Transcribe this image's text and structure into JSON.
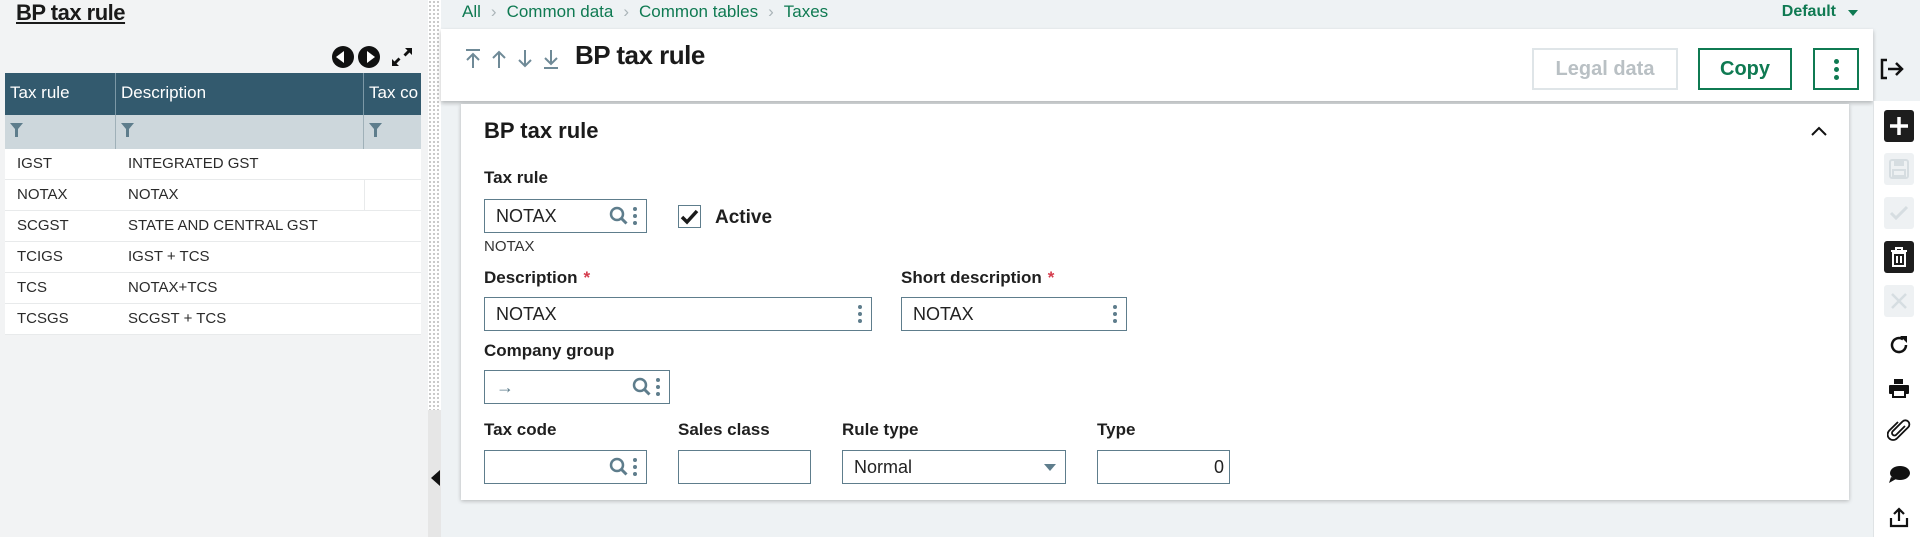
{
  "left_panel": {
    "title": "BP tax rule",
    "grid": {
      "columns": [
        "Tax rule",
        "Description",
        "Tax co"
      ],
      "rows": [
        {
          "tax_rule": "IGST",
          "description": "INTEGRATED GST"
        },
        {
          "tax_rule": "NOTAX",
          "description": "NOTAX",
          "selected": true
        },
        {
          "tax_rule": "SCGST",
          "description": "STATE AND CENTRAL GST"
        },
        {
          "tax_rule": "TCIGS",
          "description": "IGST + TCS"
        },
        {
          "tax_rule": "TCS",
          "description": "NOTAX+TCS"
        },
        {
          "tax_rule": "TCSGS",
          "description": "SCGST + TCS"
        }
      ]
    }
  },
  "breadcrumb": [
    "All",
    "Common data",
    "Common tables",
    "Taxes"
  ],
  "view_selector": "Default",
  "header": {
    "title": "BP tax rule",
    "buttons": {
      "legal_data": "Legal data",
      "copy": "Copy"
    }
  },
  "section": {
    "title": "BP tax rule",
    "fields": {
      "tax_rule": {
        "label": "Tax rule",
        "value": "NOTAX",
        "sub_value": "NOTAX"
      },
      "active": {
        "label": "Active",
        "checked": true
      },
      "description": {
        "label": "Description",
        "required_mark": "*",
        "value": "NOTAX"
      },
      "short_description": {
        "label": "Short description",
        "required_mark": "*",
        "value": "NOTAX"
      },
      "company_group": {
        "label": "Company group",
        "value": "→"
      },
      "tax_code": {
        "label": "Tax code",
        "value": ""
      },
      "sales_class": {
        "label": "Sales class",
        "value": ""
      },
      "rule_type": {
        "label": "Rule type",
        "value": "Normal"
      },
      "type": {
        "label": "Type",
        "value": "0"
      }
    }
  },
  "colors": {
    "accent": "#0f7a52",
    "grid_header": "#335a6e",
    "required": "#d43a4b"
  }
}
